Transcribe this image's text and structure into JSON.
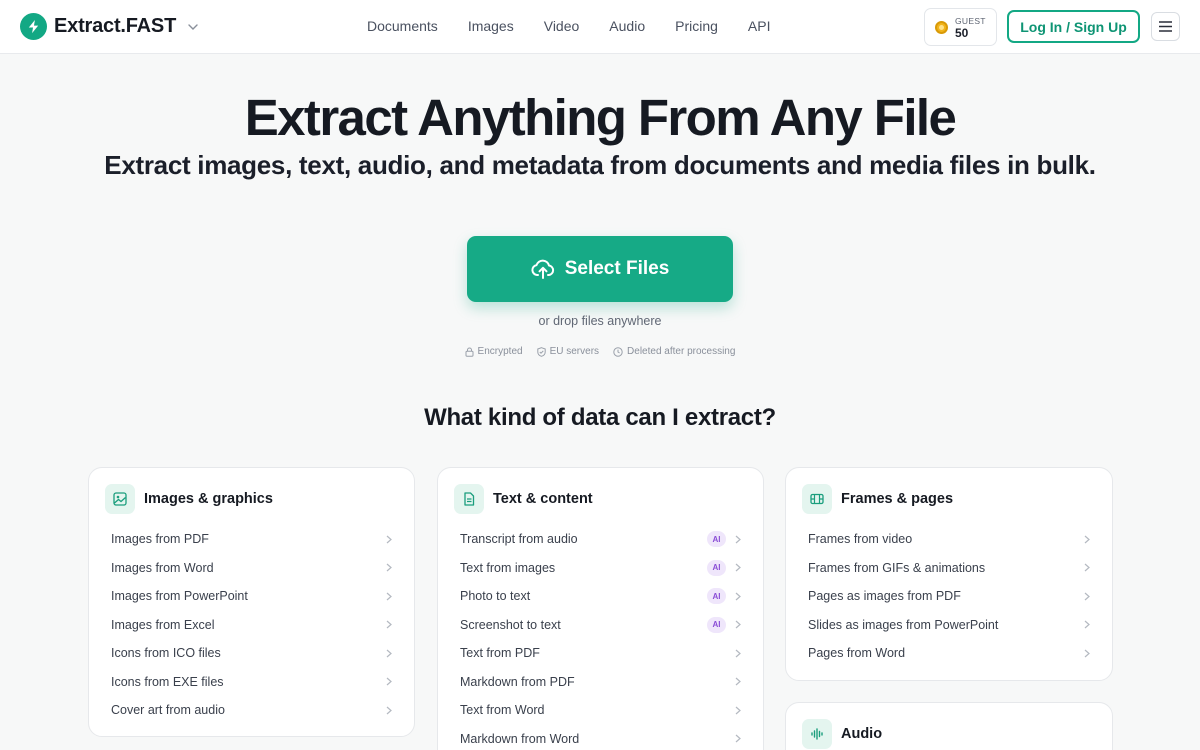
{
  "header": {
    "brand": "Extract.FAST",
    "nav": [
      "Documents",
      "Images",
      "Video",
      "Audio",
      "Pricing",
      "API"
    ],
    "credits_label": "GUEST",
    "credits_value": "50",
    "login_label": "Log In / Sign Up"
  },
  "hero": {
    "title": "Extract Anything From Any File",
    "subtitle": "Extract images, text, audio, and metadata from documents and media files in bulk.",
    "select_label": "Select Files",
    "drop_hint": "or drop files anywhere",
    "trust": [
      "Encrypted",
      "EU servers",
      "Deleted after processing"
    ]
  },
  "section_title": "What kind of data can I extract?",
  "categories": [
    {
      "title": "Images & graphics",
      "items": [
        {
          "label": "Images from PDF"
        },
        {
          "label": "Images from Word"
        },
        {
          "label": "Images from PowerPoint"
        },
        {
          "label": "Images from Excel"
        },
        {
          "label": "Icons from ICO files"
        },
        {
          "label": "Icons from EXE files"
        },
        {
          "label": "Cover art from audio"
        }
      ]
    },
    {
      "title": "Text & content",
      "items": [
        {
          "label": "Transcript from audio",
          "badge": "AI"
        },
        {
          "label": "Text from images",
          "badge": "AI"
        },
        {
          "label": "Photo to text",
          "badge": "AI"
        },
        {
          "label": "Screenshot to text",
          "badge": "AI"
        },
        {
          "label": "Text from PDF"
        },
        {
          "label": "Markdown from PDF"
        },
        {
          "label": "Text from Word"
        },
        {
          "label": "Markdown from Word"
        }
      ]
    },
    {
      "title": "Frames & pages",
      "items": [
        {
          "label": "Frames from video"
        },
        {
          "label": "Frames from GIFs & animations"
        },
        {
          "label": "Pages as images from PDF"
        },
        {
          "label": "Slides as images from PowerPoint"
        },
        {
          "label": "Pages from Word"
        }
      ]
    },
    {
      "title": "Audio",
      "items": []
    }
  ],
  "colors": {
    "accent": "#16aa86",
    "ai_badge_bg": "#efe6fb",
    "ai_badge_text": "#8a4dd6"
  }
}
